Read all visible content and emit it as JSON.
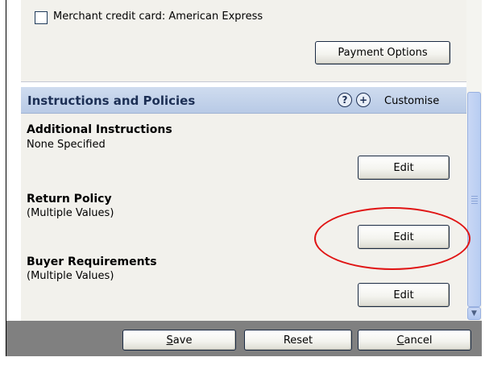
{
  "payment": {
    "checkbox_label": "Merchant credit card: American Express",
    "checkbox_checked": false,
    "options_button": "Payment Options"
  },
  "section": {
    "title": "Instructions and Policies",
    "help_icon": "?",
    "add_icon": "+",
    "customise_label": "Customise"
  },
  "items": [
    {
      "title": "Additional Instructions",
      "value": "None Specified",
      "button": "Edit"
    },
    {
      "title": "Return Policy",
      "value": "(Multiple Values)",
      "button": "Edit"
    },
    {
      "title": "Buyer Requirements",
      "value": "(Multiple Values)",
      "button": "Edit"
    }
  ],
  "footer": {
    "save_label": "Save",
    "reset_label": "Reset",
    "cancel_label": "Cancel"
  },
  "annotation": {
    "color": "#e01414"
  }
}
